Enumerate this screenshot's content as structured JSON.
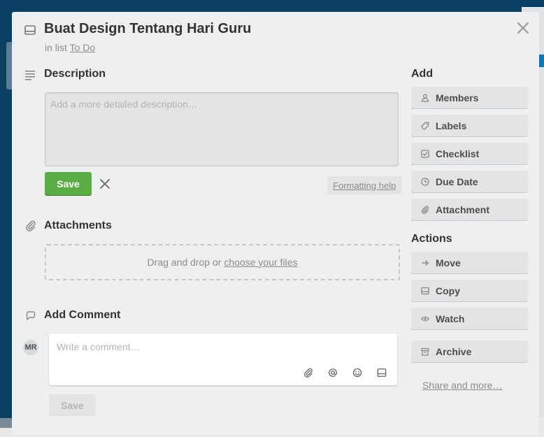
{
  "card": {
    "title": "Buat Design Tentang Hari Guru",
    "in_list_prefix": "in list",
    "list_name": "To Do"
  },
  "description": {
    "title": "Description",
    "placeholder": "Add a more detailed description…",
    "save_label": "Save",
    "formatting_help": "Formatting help"
  },
  "attachments": {
    "title": "Attachments",
    "drop_text": "Drag and drop or",
    "choose_files": "choose your files"
  },
  "comment": {
    "title": "Add Comment",
    "avatar_initials": "MR",
    "placeholder": "Write a comment…",
    "save_label": "Save"
  },
  "sidebar": {
    "add_title": "Add",
    "add_items": [
      {
        "label": "Members",
        "icon": "person-icon"
      },
      {
        "label": "Labels",
        "icon": "tag-icon"
      },
      {
        "label": "Checklist",
        "icon": "checkbox-icon"
      },
      {
        "label": "Due Date",
        "icon": "clock-icon"
      },
      {
        "label": "Attachment",
        "icon": "paperclip-icon"
      }
    ],
    "actions_title": "Actions",
    "action_items": [
      {
        "label": "Move",
        "icon": "arrow-right-icon"
      },
      {
        "label": "Copy",
        "icon": "card-icon"
      },
      {
        "label": "Watch",
        "icon": "eye-icon"
      },
      {
        "label": "Archive",
        "icon": "archive-icon"
      }
    ],
    "share_label": "Share and more…"
  },
  "colors": {
    "save_green": "#5aac44",
    "modal_bg": "#edeff0",
    "board_bg": "#0b3f62"
  }
}
